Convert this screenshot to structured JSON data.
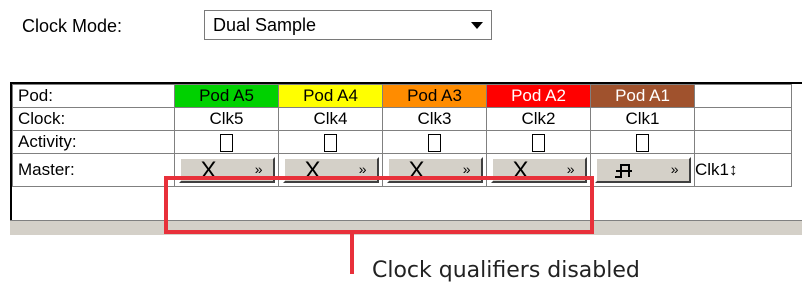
{
  "clock_mode": {
    "label": "Clock Mode:",
    "value": "Dual Sample"
  },
  "rows": {
    "pod": "Pod:",
    "clock": "Clock:",
    "activity": "Activity:",
    "master": "Master:"
  },
  "pods": [
    {
      "name": "Pod A5",
      "clock": "Clk5",
      "color": "#00d100"
    },
    {
      "name": "Pod A4",
      "clock": "Clk4",
      "color": "#ffff00"
    },
    {
      "name": "Pod A3",
      "clock": "Clk3",
      "color": "#ff8c00"
    },
    {
      "name": "Pod A2",
      "clock": "Clk2",
      "color": "#ff0000"
    },
    {
      "name": "Pod A1",
      "clock": "Clk1",
      "color": "#a0522d"
    }
  ],
  "master": {
    "qualifiers": [
      {
        "symbol": "X",
        "state": "disabled"
      },
      {
        "symbol": "X",
        "state": "disabled"
      },
      {
        "symbol": "X",
        "state": "disabled"
      },
      {
        "symbol": "X",
        "state": "disabled"
      },
      {
        "symbol": "⊓̶",
        "state": "rising"
      }
    ],
    "chevron": "»",
    "clock_select": "Clk1↕"
  },
  "annotation": {
    "text": "Clock qualifiers disabled",
    "color": "#e8303a"
  }
}
